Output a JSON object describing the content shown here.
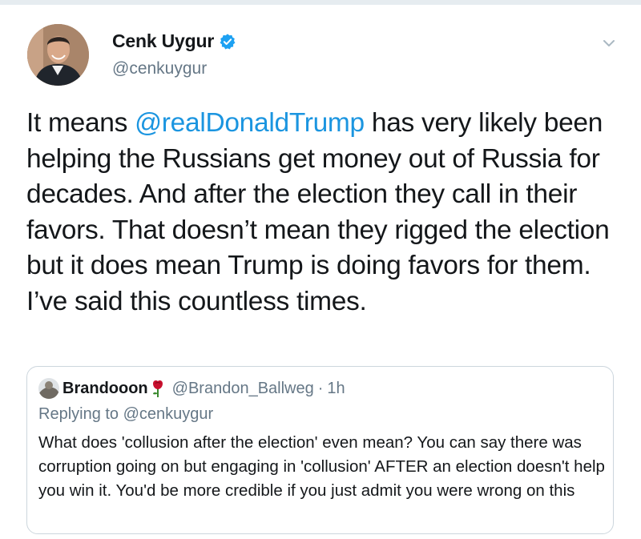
{
  "tweet": {
    "author": {
      "display_name": "Cenk Uygur",
      "handle": "@cenkuygur",
      "verified": true,
      "avatar_icon": "profile-photo"
    },
    "menu_icon": "chevron-down-icon",
    "text": {
      "before_mention": "It means ",
      "mention": "@realDonaldTrump",
      "after_mention": " has very likely been helping the Russians get money out of Russia for decades. And after the election they call in their favors. That doesn’t mean they rigged the election but it does mean Trump is doing favors for them. I’ve said this countless times."
    }
  },
  "quoted_tweet": {
    "author": {
      "display_name": "Brandooon",
      "emoji_icon": "rose-icon",
      "handle": "@Brandon_Ballweg",
      "separator": "·",
      "time": "1h"
    },
    "replying_to": "Replying to @cenkuygur",
    "text": "What does 'collusion after the election' even mean? You can say there was corruption going on but engaging in 'collusion' AFTER an election doesn't help you win it. You'd be more credible if you just admit you were wrong on this"
  },
  "colors": {
    "text": "#14171a",
    "secondary": "#657786",
    "link": "#1b95e0",
    "verified": "#1da1f2",
    "border": "#ccd6dd"
  }
}
